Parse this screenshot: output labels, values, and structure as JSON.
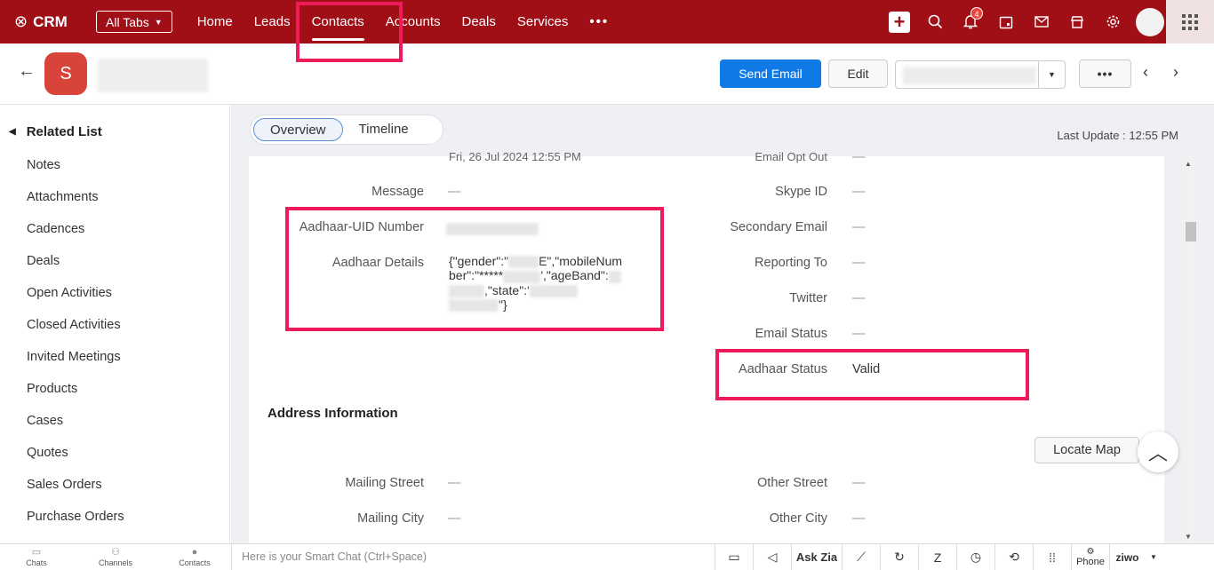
{
  "topbar": {
    "app_name": "CRM",
    "all_tabs_label": "All Tabs",
    "nav": [
      "Home",
      "Leads",
      "Contacts",
      "Accounts",
      "Deals",
      "Services"
    ],
    "more": "•••",
    "notification_count": "4"
  },
  "record": {
    "avatar_letter": "S",
    "send_email_label": "Send Email",
    "edit_label": "Edit",
    "more_label": "•••"
  },
  "sidebar": {
    "title": "Related List",
    "items": [
      "Notes",
      "Attachments",
      "Cadences",
      "Deals",
      "Open Activities",
      "Closed Activities",
      "Invited Meetings",
      "Products",
      "Cases",
      "Quotes",
      "Sales Orders",
      "Purchase Orders"
    ]
  },
  "main": {
    "tabs": [
      "Overview",
      "Timeline"
    ],
    "last_update": "Last Update : 12:55 PM",
    "cut_left_value": "Fri, 26 Jul 2024 12:55 PM",
    "cut_right_label": "Email Opt Out",
    "left_fields": {
      "message": {
        "label": "Message",
        "value": "—"
      },
      "aadhaar_uid": {
        "label": "Aadhaar-UID Number"
      },
      "aadhaar_details": {
        "label": "Aadhaar Details",
        "line1_a": "{\"gender\":\"",
        "line1_b": "E\",\"mobileNum",
        "line2_a": "ber\":\"*****",
        "line2_b": "',\"ageBand\":",
        "line3": ",\"state\":'",
        "line4": "\"}"
      }
    },
    "right_fields": {
      "email_opt_out_value": "—",
      "skype": {
        "label": "Skype ID",
        "value": "—"
      },
      "secondary_email": {
        "label": "Secondary Email",
        "value": "—"
      },
      "reporting_to": {
        "label": "Reporting To",
        "value": "—"
      },
      "twitter": {
        "label": "Twitter",
        "value": "—"
      },
      "email_status": {
        "label": "Email Status",
        "value": "—"
      },
      "aadhaar_status": {
        "label": "Aadhaar Status",
        "value": "Valid"
      }
    },
    "address": {
      "title": "Address Information",
      "locate_map": "Locate Map",
      "mailing_street": {
        "label": "Mailing Street",
        "value": "—"
      },
      "mailing_city": {
        "label": "Mailing City",
        "value": "—"
      },
      "other_street": {
        "label": "Other Street",
        "value": "—"
      },
      "other_city": {
        "label": "Other City",
        "value": "—"
      }
    }
  },
  "bottombar": {
    "left": [
      "Chats",
      "Channels",
      "Contacts"
    ],
    "chat_placeholder": "Here is your Smart Chat (Ctrl+Space)",
    "ask_zia": "Ask Zia",
    "phone": "Phone",
    "brand": "ziwo"
  },
  "colors": {
    "topbar": "#a00e16",
    "primary": "#0f7ae5",
    "highlight": "#ee1b5a"
  }
}
